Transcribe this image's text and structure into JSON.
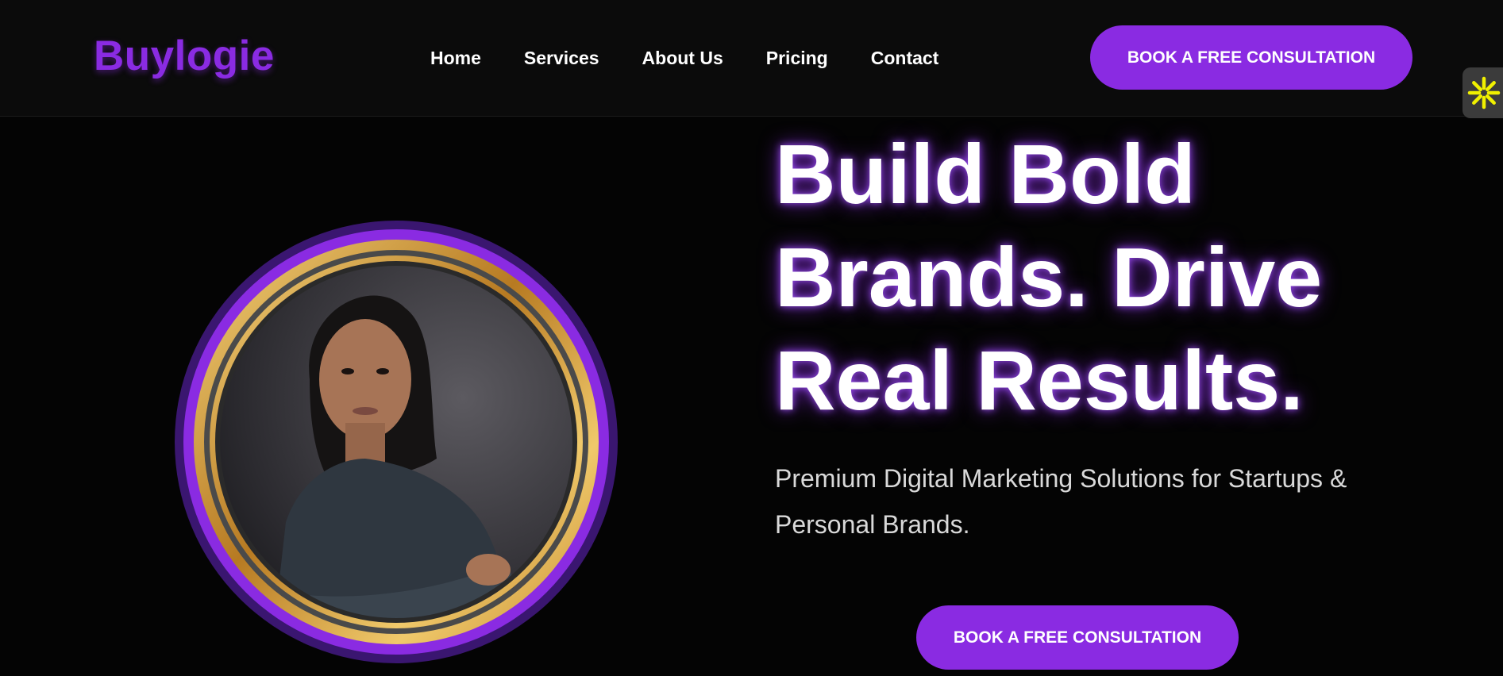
{
  "header": {
    "logo": "Buylogie",
    "nav": [
      {
        "label": "Home"
      },
      {
        "label": "Services"
      },
      {
        "label": "About Us"
      },
      {
        "label": "Pricing"
      },
      {
        "label": "Contact"
      }
    ],
    "cta_label": "BOOK A FREE CONSULTATION"
  },
  "side_widget": {
    "icon": "asterisk-icon",
    "color": "#f0f000"
  },
  "hero": {
    "headline_lines": [
      "Build Bold",
      "Brands. Drive",
      "Real Results."
    ],
    "subheading": "Premium Digital Marketing Solutions for Startups & Personal Brands.",
    "cta_label": "BOOK A FREE CONSULTATION",
    "portrait": {
      "description_icon": "profile-photo",
      "ring_colors": [
        "#8a2be2",
        "#d6a244"
      ]
    }
  },
  "colors": {
    "accent": "#8a2be2",
    "background": "#040404",
    "header_bg": "#0b0b0b",
    "gold": "#d6a244"
  }
}
